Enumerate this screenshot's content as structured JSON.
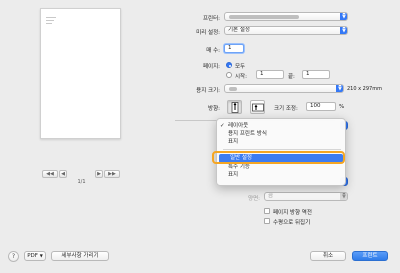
{
  "preview": {
    "page_indicator": "1/1",
    "nav": {
      "first": "◀◀",
      "prev": "◀",
      "next": "▶",
      "last": "▶▶"
    }
  },
  "form": {
    "printer": {
      "label": "프린터:",
      "value": ""
    },
    "presets": {
      "label": "미리 설정:",
      "value": "기본 설정"
    },
    "copies": {
      "label": "매 수:",
      "value": "1"
    },
    "pages": {
      "label": "페이지:",
      "all": "모두",
      "from_label": "시작:",
      "from_value": "1",
      "to_label": "끝:",
      "to_value": "1"
    },
    "paper_size": {
      "label": "용지 크기:",
      "value": "",
      "dimensions": "210 x 297mm"
    },
    "orientation": {
      "label": "방향:"
    },
    "scale": {
      "label": "크기 조정:",
      "value": "100",
      "unit": "%"
    },
    "two_sided": {
      "label": "양면:",
      "value": "끔"
    },
    "checkbox1": "페이지 방향 역전",
    "checkbox2": "수평으로 뒤집기"
  },
  "menu": {
    "items": [
      {
        "label": "레이아웃",
        "checked": true
      },
      {
        "label": "용지 프린트 방식",
        "checked": false
      },
      {
        "label": "표지",
        "checked": false
      },
      {
        "label": "일반 설정",
        "checked": false,
        "highlighted": true
      },
      {
        "label": "특수 기능",
        "checked": false
      },
      {
        "label": "표지",
        "checked": false
      }
    ]
  },
  "footer": {
    "help": "?",
    "pdf": "PDF",
    "details": "세부사항 가리기",
    "cancel": "취소",
    "print": "프린트"
  },
  "colors": {
    "accent": "#3478f6",
    "highlight_ring": "#f5a623",
    "menu_highlight": "#3d7cf1"
  }
}
